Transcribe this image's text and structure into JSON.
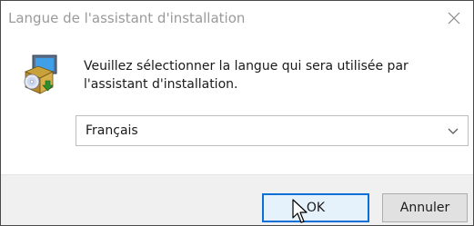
{
  "window": {
    "title": "Langue de l'assistant d'installation"
  },
  "icons": {
    "close": "close-icon",
    "app": "installer-icon",
    "dropdown": "chevron-down-icon",
    "cursor": "mouse-cursor-icon"
  },
  "content": {
    "message": "Veuillez sélectionner la langue qui sera utilisée par l'assistant d'installation."
  },
  "language_select": {
    "selected": "Français"
  },
  "buttons": {
    "ok_label": "OK",
    "cancel_label": "Annuler"
  },
  "colors": {
    "accent": "#0a6fd6",
    "footer_bg": "#f0f0f0",
    "title_text": "#9a9a9a"
  }
}
